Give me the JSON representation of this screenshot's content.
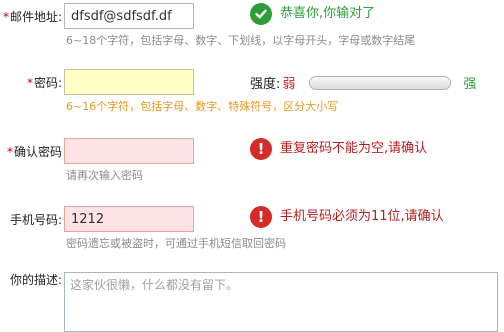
{
  "email": {
    "label": "邮件地址:",
    "value": "dfsdf@sdfsdf.df",
    "hint": "6~18个字符，包括字母、数字、下划线，以字母开头，字母或数字结尾",
    "status": "success",
    "message": "恭喜你,你输对了"
  },
  "password": {
    "label": "密码:",
    "value": "",
    "hint": "6~16个字符，包括字母、数字、特殊符号，区分大小写",
    "strength": {
      "label": "强度:",
      "weak": "弱",
      "strong": "强",
      "level": 0
    }
  },
  "confirm": {
    "label": "确认密码",
    "value": "",
    "hint": "请再次输入密码",
    "status": "error",
    "message": "重复密码不能为空,请确认"
  },
  "phone": {
    "label": "手机号码:",
    "value": "1212",
    "hint": "密码遗忘或被盗时，可通过手机短信取回密码",
    "status": "error",
    "message": "手机号码必须为11位,请确认"
  },
  "description": {
    "label": "你的描述:",
    "placeholder": "这家伙很懒，什么都没有留下。"
  },
  "required_mark": "*",
  "colors": {
    "success": "#2e9d3a",
    "error": "#b81d1d",
    "hint_active": "#e59a1c",
    "focus_bg": "#ffffc6",
    "error_bg": "#fde3e3"
  },
  "icons": {
    "success": "check-circle-icon",
    "error": "exclamation-circle-icon"
  }
}
